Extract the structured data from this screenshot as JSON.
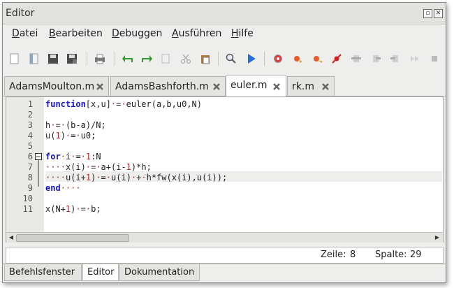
{
  "window": {
    "title": "Editor"
  },
  "menu": {
    "items": [
      {
        "label": "Datei",
        "key": "D",
        "rest": "atei"
      },
      {
        "label": "Bearbeiten",
        "key": "B",
        "rest": "earbeiten"
      },
      {
        "label": "Debuggen",
        "key": "D",
        "rest": "ebuggen"
      },
      {
        "label": "Ausführen",
        "key": "A",
        "rest": "usführen"
      },
      {
        "label": "Hilfe",
        "key": "H",
        "rest": "ilfe"
      }
    ]
  },
  "toolbar": {
    "icons": [
      "new-file-icon",
      "open-file-icon",
      "save-icon",
      "save-all-icon",
      "print-icon",
      "undo-icon",
      "redo-icon",
      "copy-icon",
      "cut-icon",
      "paste-icon",
      "find-icon",
      "run-icon",
      "breakpoint-icon",
      "step-icon",
      "step-in-icon",
      "step-out-icon",
      "continue-icon",
      "remove-breakpoint-icon",
      "next-icon",
      "stop-icon"
    ]
  },
  "tabs": [
    {
      "label": "AdamsMoulton.m",
      "active": false
    },
    {
      "label": "AdamsBashforth.m",
      "active": false
    },
    {
      "label": "euler.m",
      "active": true
    },
    {
      "label": "rk.m",
      "active": false
    }
  ],
  "editor": {
    "lines": [
      {
        "n": "1",
        "text": "function[x,u]·=·euler(a,b,u0,N)"
      },
      {
        "n": "2",
        "text": ""
      },
      {
        "n": "3",
        "text": "h·=·(b-a)/N;"
      },
      {
        "n": "4",
        "text": "u(1)·=·u0;"
      },
      {
        "n": "5",
        "text": ""
      },
      {
        "n": "6",
        "text": "for·i·=·1:N"
      },
      {
        "n": "7",
        "text": "····x(i)·=·a+(i-1)*h;"
      },
      {
        "n": "8",
        "text": "····u(i+1)·=·u(i)·+·h*fw(x(i),u(i));"
      },
      {
        "n": "9",
        "text": "end····"
      },
      {
        "n": "10",
        "text": ""
      },
      {
        "n": "11",
        "text": "x(N+1)·=·b;"
      }
    ]
  },
  "status": {
    "line_label": "Zeile:",
    "line_value": "8",
    "col_label": "Spalte:",
    "col_value": "29"
  },
  "bottom_tabs": [
    {
      "label": "Befehlsfenster",
      "active": false
    },
    {
      "label": "Editor",
      "active": true
    },
    {
      "label": "Dokumentation",
      "active": false
    }
  ]
}
